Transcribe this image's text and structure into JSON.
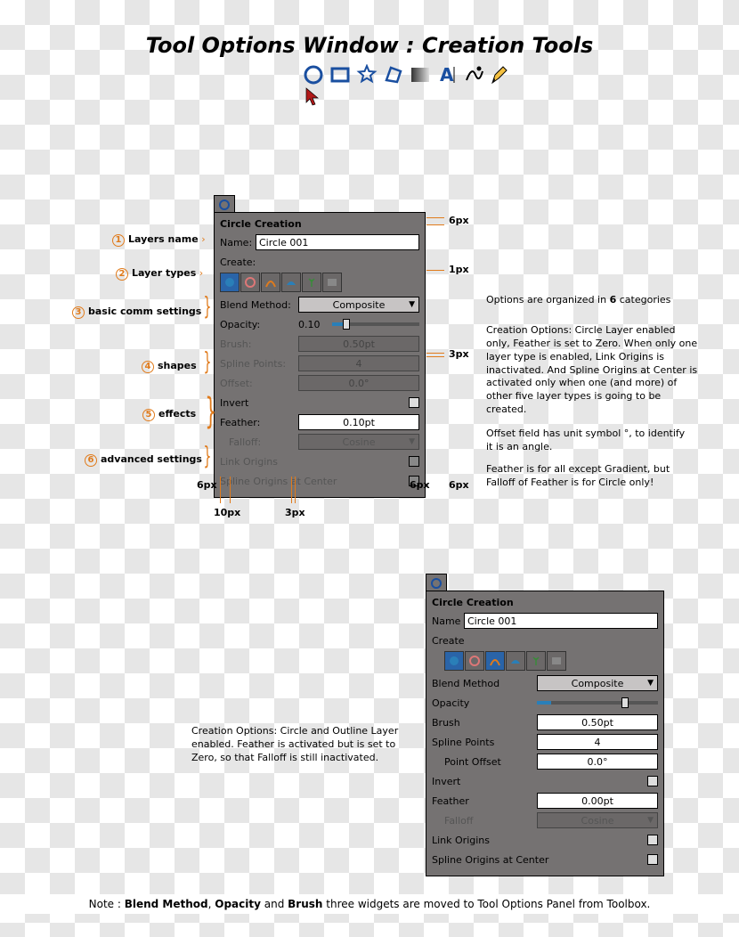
{
  "title": "Tool Options Window : Creation Tools",
  "toolbar_icons": [
    "circle",
    "rectangle",
    "star",
    "polygon",
    "gradient",
    "text",
    "spline",
    "draw"
  ],
  "panel1": {
    "header": "Circle Creation",
    "name_label": "Name:",
    "name_value": "Circle 001",
    "create_label": "Create:",
    "blend_label": "Blend Method:",
    "blend_value": "Composite",
    "opacity_label": "Opacity:",
    "opacity_value": "0.10",
    "brush_label": "Brush:",
    "brush_value": "0.50pt",
    "spline_label": "Spline Points:",
    "spline_value": "4",
    "offset_label": "Offset:",
    "offset_value": "0.0°",
    "invert_label": "Invert",
    "feather_label": "Feather:",
    "feather_value": "0.10pt",
    "falloff_label": "Falloff:",
    "falloff_value": "Cosine",
    "link_label": "Link Origins",
    "center_label": "Spline Origins at Center"
  },
  "panel2": {
    "header": "Circle Creation",
    "name_label": "Name",
    "name_value": "Circle 001",
    "create_label": "Create",
    "blend_label": "Blend Method",
    "blend_value": "Composite",
    "opacity_label": "Opacity",
    "brush_label": "Brush",
    "brush_value": "0.50pt",
    "spline_label": "Spline Points",
    "spline_value": "4",
    "offset_label": "Point Offset",
    "offset_value": "0.0°",
    "invert_label": "Invert",
    "feather_label": "Feather",
    "feather_value": "0.00pt",
    "falloff_label": "Falloff",
    "falloff_value": "Cosine",
    "link_label": "Link Origins",
    "center_label": "Spline Origins at Center"
  },
  "ann": {
    "a1": "Layers name",
    "a2": "Layer types",
    "a3": "basic comm settings",
    "a4": "shapes",
    "a5": "effects",
    "a6": "advanced settings"
  },
  "dims": {
    "d6a": "6px",
    "d1": "1px",
    "d3": "3px",
    "d6b": "6px",
    "d6c": "6px",
    "d6d": "6px",
    "d10": "10px",
    "d3b": "3px"
  },
  "rtext": {
    "r1": "Options are organized in 6 categories",
    "r2": "Creation Options: Circle Layer enabled only, Feather is set to Zero. When only one layer type is enabled, Link Origins is inactivated. And Spline Origins at Center is activated only when one (and more) of other five layer types is going to be created.",
    "r3": "Offset field has unit symbol °, to identify it is an angle.",
    "r4": "Feather is for all except Gradient, but Falloff of Feather is for Circle only!",
    "left": "Creation Options: Circle and Outline Layer enabled. Feather is activated but is set to Zero, so that Falloff is still inactivated."
  },
  "note": {
    "pre": "Note : ",
    "b1": "Blend Method",
    "b2": "Opacity",
    "b3": "Brush",
    "post": " three widgets  are moved to Tool Options Panel from Toolbox."
  }
}
